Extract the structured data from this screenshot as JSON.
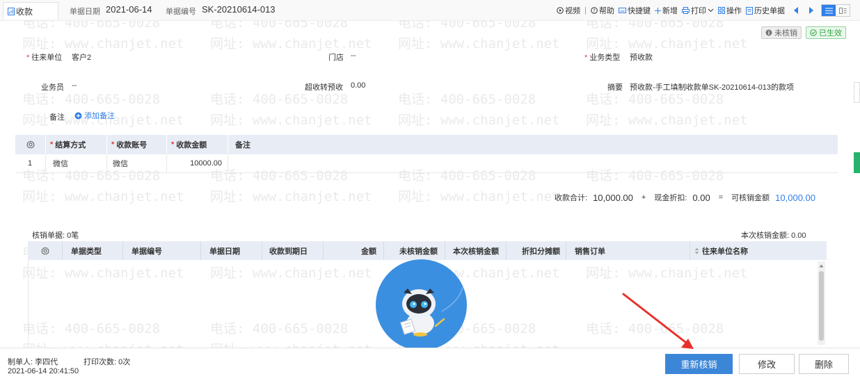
{
  "header": {
    "tab_label": "收款",
    "doc_date_label": "单据日期",
    "doc_date_value": "2021-06-14",
    "doc_no_label": "单据编号",
    "doc_no_value": "SK-20210614-013"
  },
  "toolbar": {
    "video": "视频",
    "help": "帮助",
    "shortcut": "快捷键",
    "add": "新增",
    "print": "打印",
    "operation": "操作",
    "history": "历史单据"
  },
  "status": {
    "unverified": "未核销",
    "active": "已生效"
  },
  "form": {
    "partner_label": "往来单位",
    "partner_value": "客户2",
    "store_label": "门店",
    "store_value": "--",
    "business_type_label": "业务类型",
    "business_type_value": "预收款",
    "salesman_label": "业务员",
    "salesman_value": "--",
    "overpay_label": "超收转预收",
    "overpay_value": "0.00",
    "summary_label": "摘要",
    "summary_value": "预收款-手工填制收款单SK-20210614-013的款项",
    "remark_label": "备注",
    "add_remark": "添加备注"
  },
  "payment_table": {
    "headers": [
      "结算方式",
      "收款账号",
      "收款金额",
      "备注"
    ],
    "rows": [
      {
        "index": "1",
        "method": "微信",
        "account": "微信",
        "amount": "10000.00",
        "remark": ""
      }
    ]
  },
  "totals": {
    "receipt_total_label": "收款合计:",
    "receipt_total_value": "10,000.00",
    "plus": "+",
    "discount_label": "现金折扣:",
    "discount_value": "0.00",
    "equals": "=",
    "verifiable_label": "可核销金额",
    "verifiable_value": "10,000.00"
  },
  "verification": {
    "count_text": "核销单据: 0笔",
    "amount_text": "本次核销金额: 0.00",
    "headers": [
      "单据类型",
      "单据编号",
      "单据日期",
      "收款到期日",
      "金额",
      "未核销金额",
      "本次核销金额",
      "折扣分摊额",
      "销售订单",
      "往来单位名称"
    ]
  },
  "footer": {
    "creator": "制单人: 李四代",
    "print_count": "打印次数: 0次",
    "created_at": "2021-06-14 20:41:50"
  },
  "actions": {
    "reverify": "重新核销",
    "modify": "修改",
    "delete": "删除"
  },
  "watermark": {
    "phone": "电话: 400-665-0028",
    "site": "网址: www.chanjet.net"
  },
  "colors": {
    "accent": "#2f7fe8",
    "primary_button": "#3c86d8",
    "required": "#e23b3b",
    "success": "#2fa53f",
    "table_header": "#e8edf5",
    "annotation_arrow": "#e8302a"
  }
}
